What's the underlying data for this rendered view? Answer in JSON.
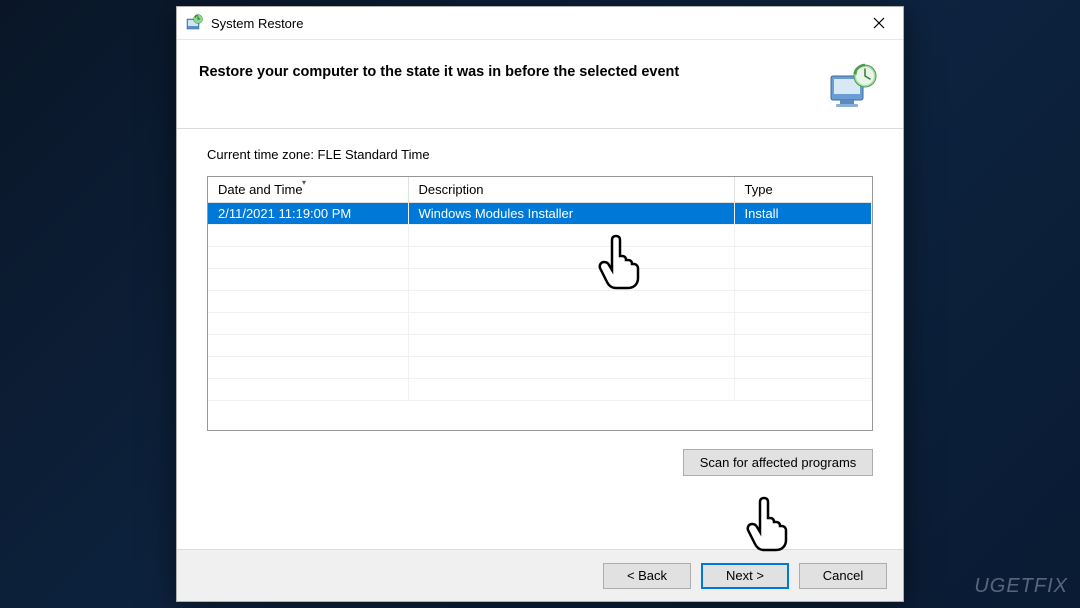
{
  "window": {
    "title": "System Restore"
  },
  "heading": "Restore your computer to the state it was in before the selected event",
  "timezone": "Current time zone: FLE Standard Time",
  "table": {
    "headers": {
      "date": "Date and Time",
      "description": "Description",
      "type": "Type"
    },
    "rows": [
      {
        "date": "2/11/2021 11:19:00 PM",
        "description": "Windows Modules Installer",
        "type": "Install"
      }
    ]
  },
  "buttons": {
    "scan": "Scan for affected programs",
    "back": "< Back",
    "next": "Next >",
    "cancel": "Cancel"
  },
  "watermark": "UGETFIX"
}
